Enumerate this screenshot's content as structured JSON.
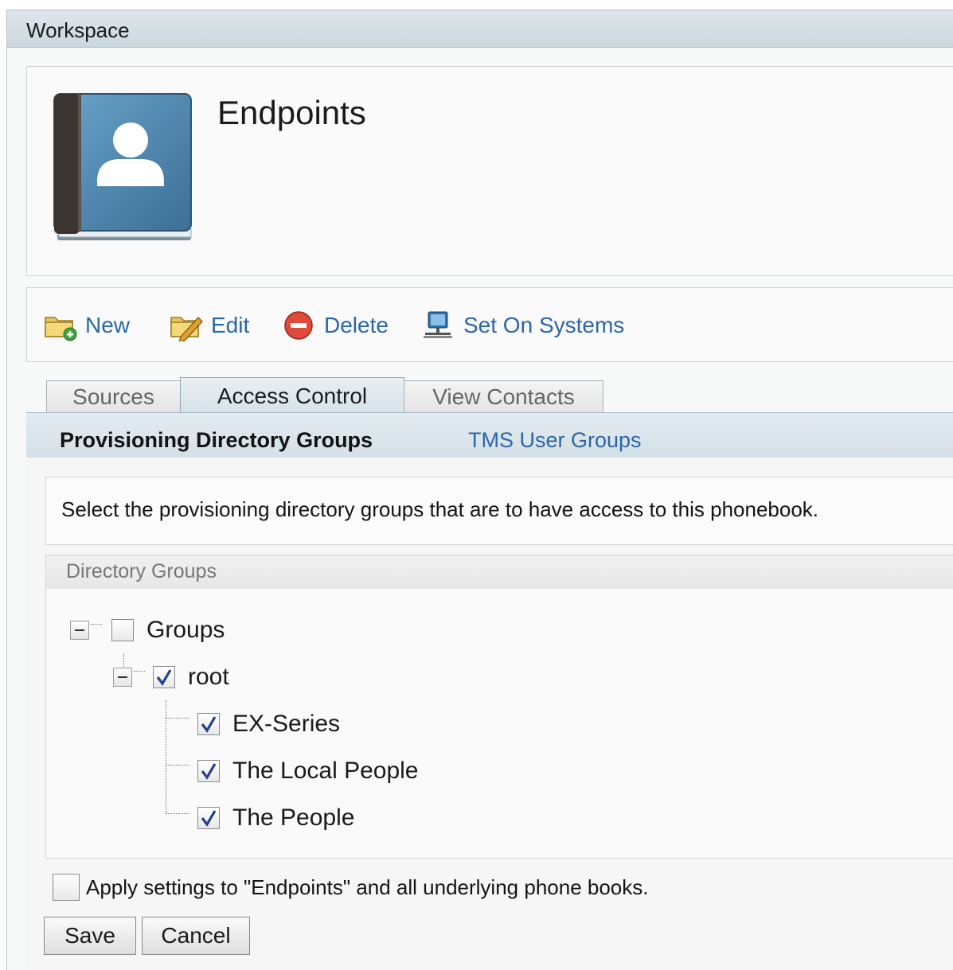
{
  "workspace": {
    "title": "Workspace"
  },
  "header": {
    "title": "Endpoints",
    "icon": "phonebook-icon"
  },
  "toolbar": {
    "new_label": "New",
    "edit_label": "Edit",
    "delete_label": "Delete",
    "set_on_systems_label": "Set On Systems"
  },
  "tabs": [
    {
      "label": "Sources",
      "active": false
    },
    {
      "label": "Access Control",
      "active": true
    },
    {
      "label": "View Contacts",
      "active": false
    }
  ],
  "subtabs": {
    "active": "Provisioning Directory Groups",
    "link": "TMS User Groups"
  },
  "info": {
    "text": "Select the provisioning directory groups that are to have access to this phonebook."
  },
  "directory_groups": {
    "title": "Directory Groups",
    "tree": [
      {
        "label": "Groups",
        "checked": false,
        "level": 0
      },
      {
        "label": "root",
        "checked": true,
        "level": 1
      },
      {
        "label": "EX-Series",
        "checked": true,
        "level": 2
      },
      {
        "label": "The Local People",
        "checked": true,
        "level": 2
      },
      {
        "label": "The People",
        "checked": true,
        "level": 2
      }
    ]
  },
  "apply": {
    "label": "Apply settings to \"Endpoints\" and all underlying phone books.",
    "checked": false
  },
  "buttons": {
    "save": "Save",
    "cancel": "Cancel"
  },
  "colors": {
    "link": "#2a66a8",
    "header_bar": "#d4e0e7",
    "book": "#4f86ad"
  }
}
